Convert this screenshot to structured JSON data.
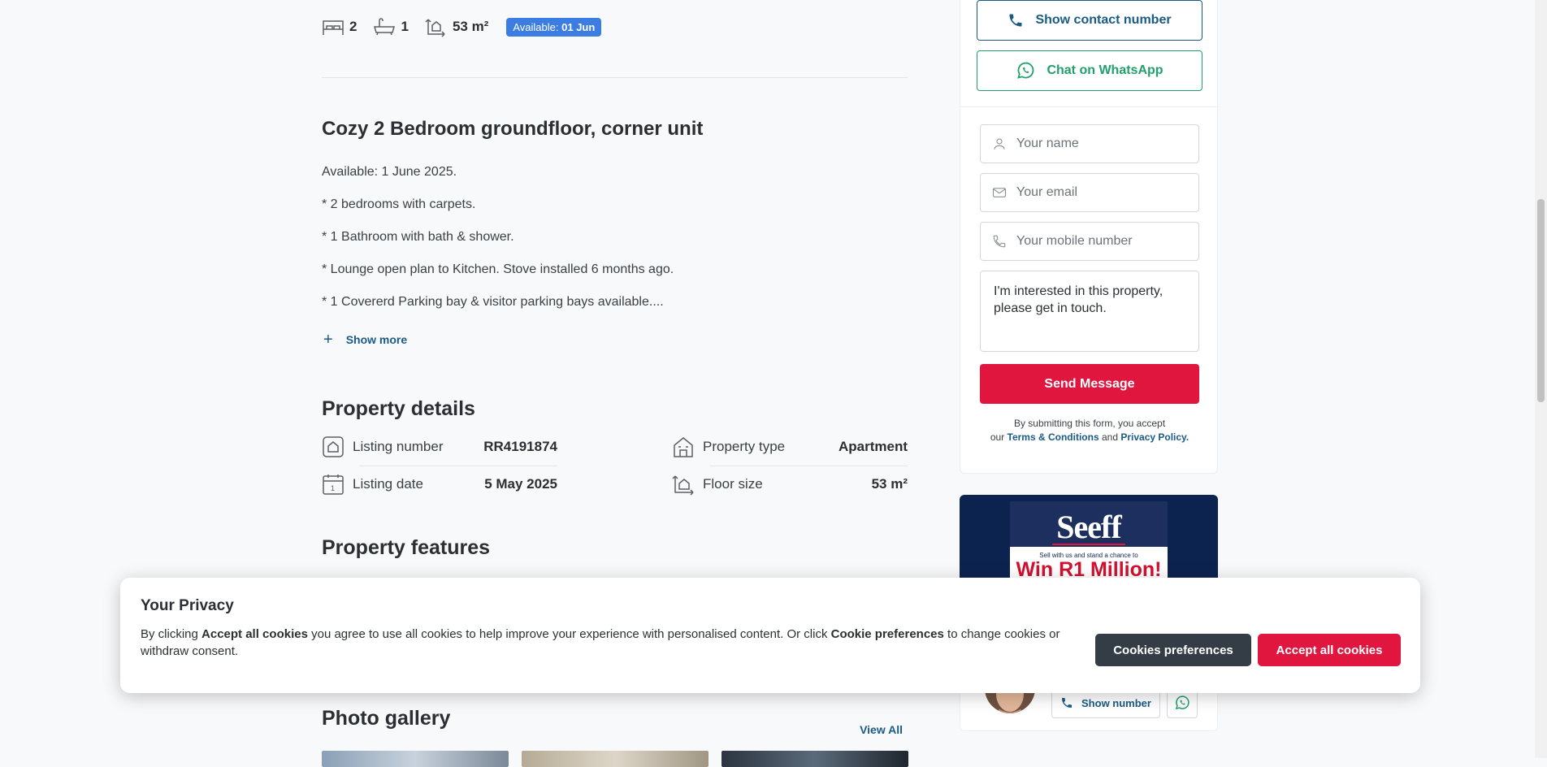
{
  "listing": {
    "beds": "2",
    "baths": "1",
    "size": "53 m²",
    "availability_prefix": "Available:",
    "availability_date": "01 Jun",
    "title": "Cozy 2 Bedroom groundfloor, corner unit",
    "description": [
      "Available: 1 June 2025.",
      "* 2 bedrooms with carpets.",
      "* 1 Bathroom with bath & shower.",
      "* Lounge open plan to Kitchen. Stove installed 6 months ago.",
      "* 1 Covererd Parking bay & visitor parking bays available...."
    ],
    "show_more": "Show more"
  },
  "details": {
    "heading": "Property details",
    "items": [
      {
        "label": "Listing number",
        "value": "RR4191874",
        "icon": "listing-number-icon"
      },
      {
        "label": "Property type",
        "value": "Apartment",
        "icon": "property-type-icon"
      },
      {
        "label": "Listing date",
        "value": "5 May 2025",
        "icon": "calendar-icon"
      },
      {
        "label": "Floor size",
        "value": "53 m²",
        "icon": "floor-size-icon"
      }
    ]
  },
  "features": {
    "heading": "Property features"
  },
  "gallery": {
    "heading": "Photo gallery",
    "view_all": "View All"
  },
  "contact": {
    "show_number": "Show contact number",
    "whatsapp": "Chat on WhatsApp",
    "name_placeholder": "Your name",
    "email_placeholder": "Your email",
    "mobile_placeholder": "Your mobile number",
    "message": "I'm interested in this property, please get in touch.",
    "send": "Send Message",
    "terms_prefix": "By submitting this form, you accept",
    "terms_our": "our",
    "terms_link": "Terms & Conditions",
    "terms_and": "and",
    "privacy_link": "Privacy Policy."
  },
  "ad": {
    "brand": "Seeff",
    "tagline": "Sell with us and stand a chance to",
    "headline": "Win R1 Million!"
  },
  "agent": {
    "show_number": "Show number"
  },
  "cookie": {
    "title": "Your Privacy",
    "text_1": "By clicking",
    "text_accept": "Accept all cookies",
    "text_2": "you agree to use all cookies to help improve your experience with personalised content. Or click",
    "text_prefs": "Cookie preferences",
    "text_3": "to change cookies or withdraw consent.",
    "prefs_button": "Cookies preferences",
    "accept_button": "Accept all cookies"
  },
  "colors": {
    "accent_blue": "#1a5b85",
    "badge_blue": "#3b7de0",
    "brand_red": "#e0163e",
    "whatsapp_green": "#22a06b"
  }
}
